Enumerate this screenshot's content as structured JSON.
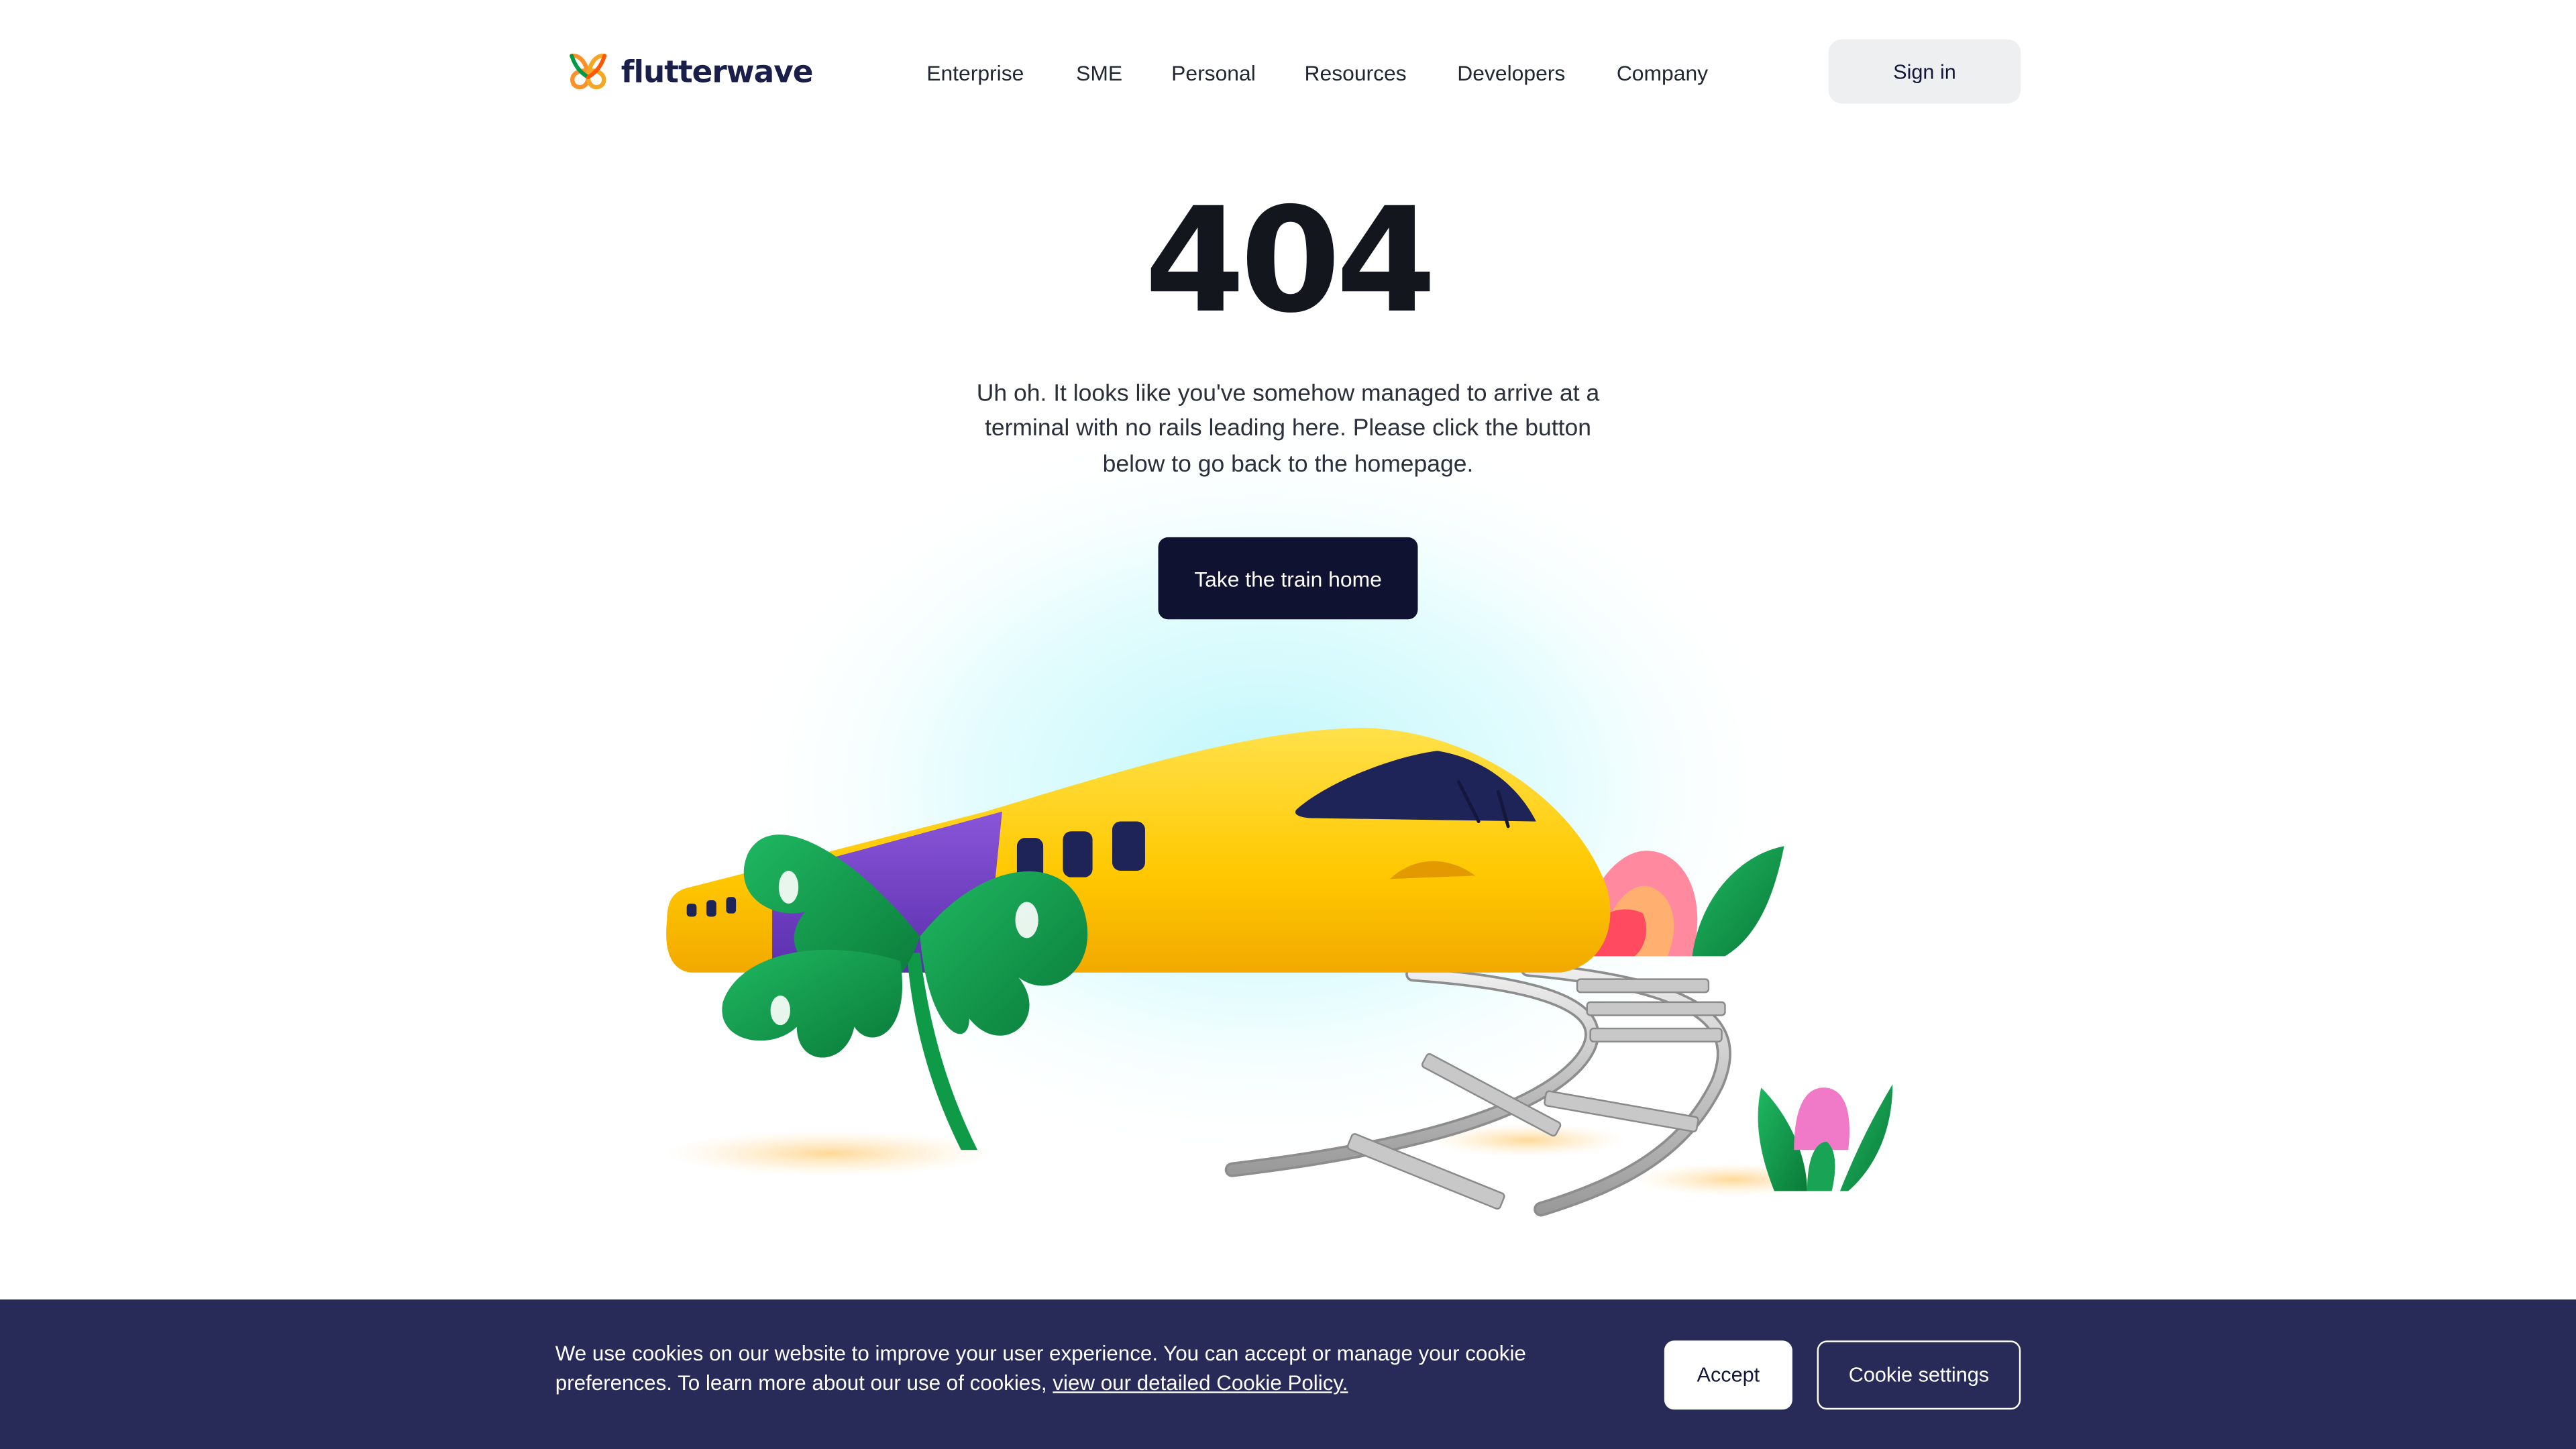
{
  "header": {
    "logo_text": "flutterwave",
    "nav": [
      {
        "label": "Enterprise"
      },
      {
        "label": "SME"
      },
      {
        "label": "Personal"
      },
      {
        "label": "Resources"
      },
      {
        "label": "Developers"
      },
      {
        "label": "Company"
      }
    ],
    "sign_in_label": "Sign in"
  },
  "main": {
    "error_code": "404",
    "message": "Uh oh. It looks like you've somehow managed to arrive at a terminal with no rails leading here. Please click the button below to go back to the homepage.",
    "cta_label": "Take the train home"
  },
  "cookie_banner": {
    "text": "We use cookies on our website to improve your user experience. You can accept or manage your cookie preferences. To learn more about our use of cookies, ",
    "link_text": "view our detailed Cookie Policy.",
    "accept_label": "Accept",
    "settings_label": "Cookie settings"
  },
  "colors": {
    "brand_navy": "#0f1231",
    "banner_bg": "#282b57",
    "train_yellow": "#ffcc00",
    "train_purple": "#6a3fc0",
    "leaf_green": "#0f9a48"
  },
  "icons": {
    "logo": "flutterwave-butterfly-logo",
    "illustration": "train-off-rails-illustration"
  }
}
